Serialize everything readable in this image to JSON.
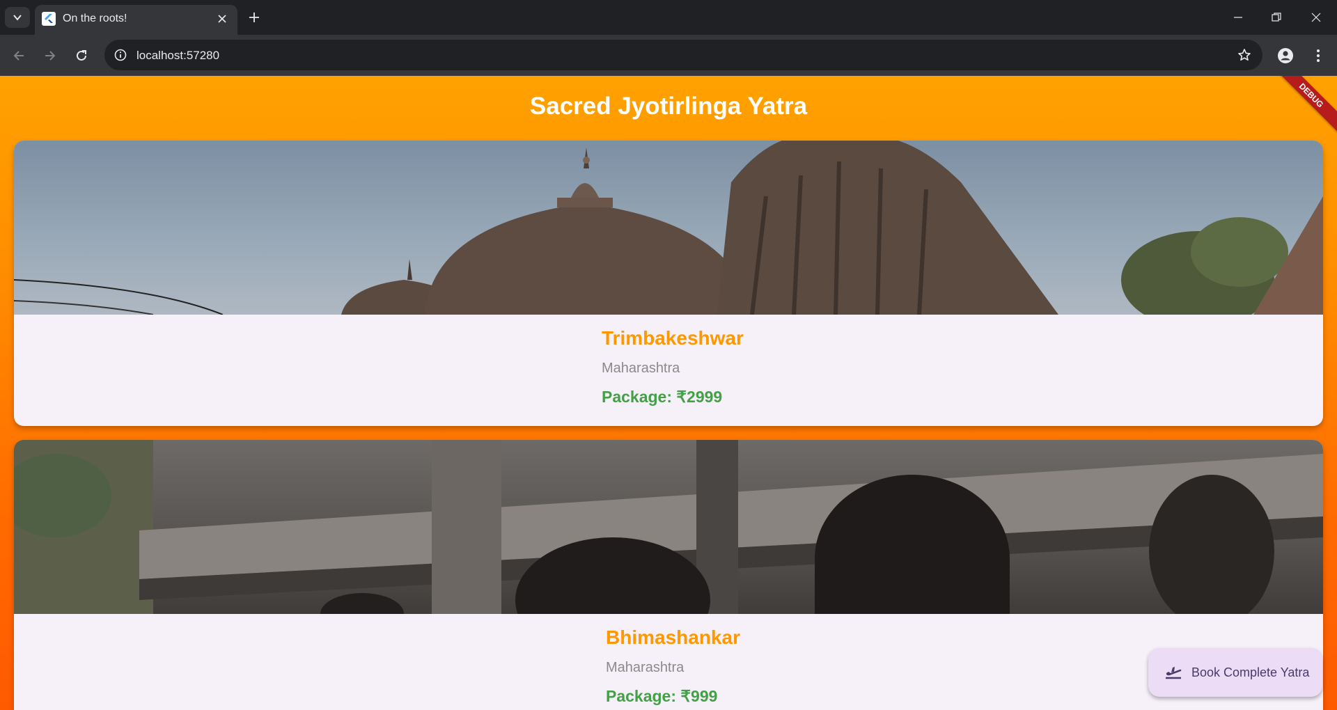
{
  "browser": {
    "tab_title": "On the roots!",
    "url": "localhost:57280"
  },
  "app": {
    "title": "Sacred Jyotirlinga Yatra",
    "debug_label": "DEBUG",
    "fab_label": "Book Complete Yatra",
    "colors": {
      "accent_orange": "#ff9800",
      "price_green": "#43a047",
      "card_bg": "#f6f0f8",
      "fab_bg": "#ecdcf5"
    }
  },
  "temples": [
    {
      "name": "Trimbakeshwar",
      "state": "Maharashtra",
      "price": "Package: ₹2999"
    },
    {
      "name": "Bhimashankar",
      "state": "Maharashtra",
      "price": "Package: ₹999"
    }
  ]
}
